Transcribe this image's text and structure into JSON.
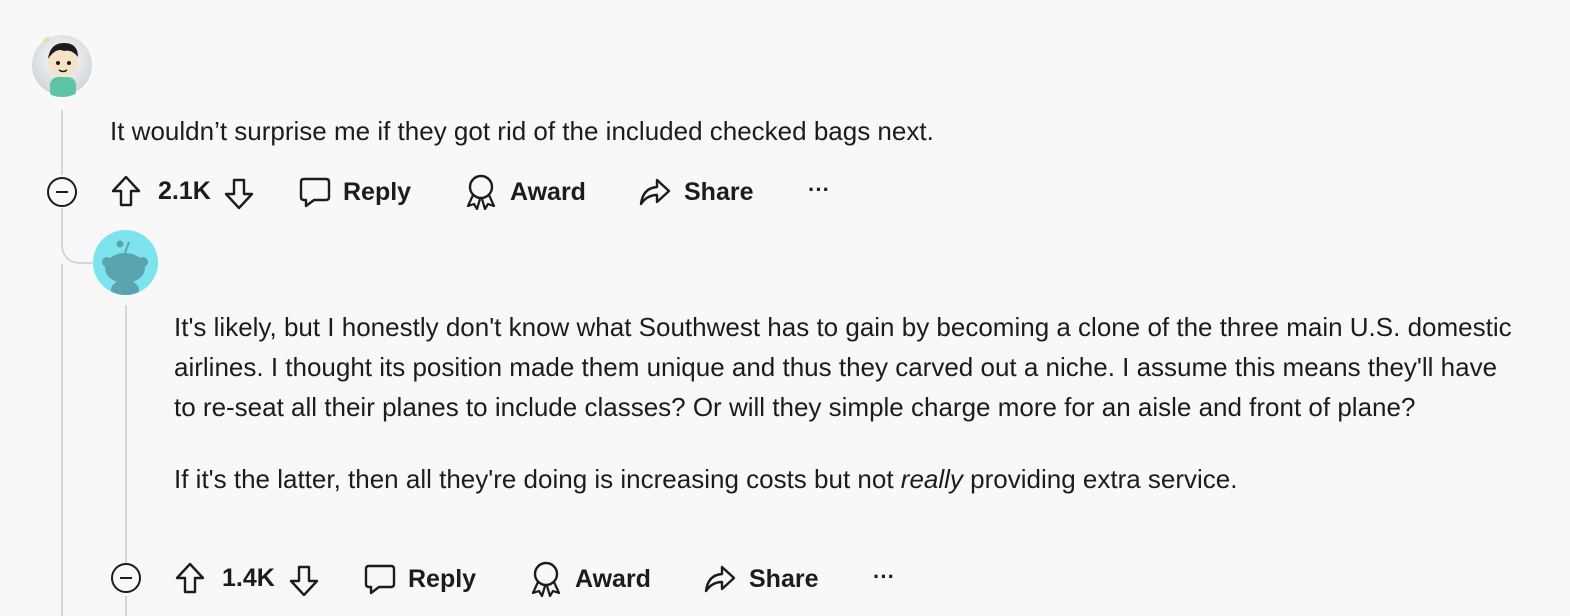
{
  "comments": [
    {
      "text": "It wouldn’t surprise me if they got rid of the included checked bags next.",
      "votes": "2.1K",
      "actions": {
        "reply": "Reply",
        "award": "Award",
        "share": "Share",
        "more": "···"
      }
    },
    {
      "paragraphs": [
        "It's likely, but I honestly don't know what Southwest has to gain by becoming a clone of the three main U.S. domestic airlines. I thought its position made them unique and thus they carved out a niche. I assume this means they'll have to re-seat all their planes to include classes? Or will they simple charge more for an aisle and front of plane?",
        "If it's the latter, then all they're doing is increasing costs but not "
      ],
      "emphasis": "really",
      "tail": " providing extra service.",
      "votes": "1.4K",
      "actions": {
        "reply": "Reply",
        "award": "Award",
        "share": "Share",
        "more": "···"
      }
    }
  ],
  "icons": {
    "upvote": "arrow-up-icon",
    "downvote": "arrow-down-icon",
    "reply": "speech-bubble-icon",
    "award": "award-ribbon-icon",
    "share": "share-arrow-icon",
    "collapse": "minus-circle-icon"
  },
  "colors": {
    "background": "#f8f8f8",
    "thread": "#d4d7d9",
    "avatar2_bg": "#7de3ef"
  }
}
